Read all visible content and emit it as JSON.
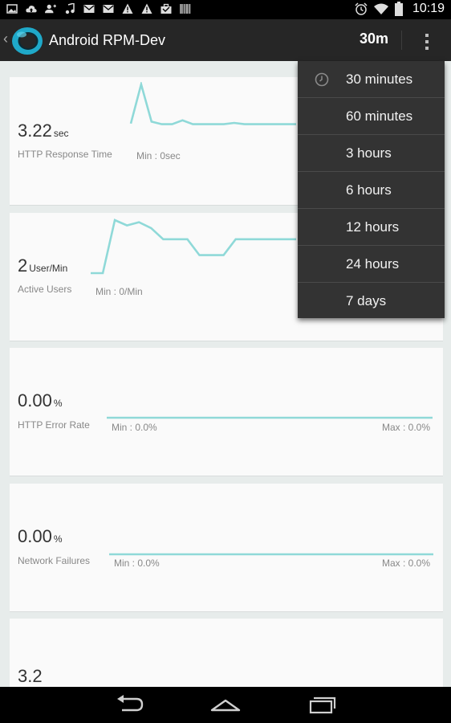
{
  "status_bar": {
    "time": "10:19",
    "left_icons": [
      "image-icon",
      "cloud-upload-icon",
      "add-contact-icon",
      "music-note-icon",
      "mail-icon",
      "mail-icon",
      "warning-icon",
      "warning-icon",
      "briefcase-icon",
      "barcode-icon"
    ],
    "right_icons": [
      "alarm-icon",
      "wifi-icon",
      "battery-icon"
    ]
  },
  "action_bar": {
    "back_glyph": "‹",
    "title": "Android RPM-Dev",
    "range_label": "30m"
  },
  "metrics": [
    {
      "value": "3.22",
      "unit": "sec",
      "label": "HTTP Response Time",
      "min_label": "Min : 0sec",
      "max_label": "",
      "series": [
        0.39,
        1.0,
        0.42,
        0.38,
        0.38,
        0.44,
        0.38,
        0.38,
        0.38,
        0.38,
        0.4,
        0.38,
        0.38,
        0.38,
        0.38,
        0.38,
        0.38
      ]
    },
    {
      "value": "2",
      "unit": "User/Min",
      "label": "Active Users",
      "min_label": "Min : 0/Min",
      "max_label": "",
      "series": [
        0.0,
        0.0,
        1.0,
        0.9,
        0.96,
        0.85,
        0.64,
        0.64,
        0.64,
        0.34,
        0.34,
        0.34,
        0.64,
        0.64,
        0.64,
        0.64,
        0.64,
        0.64
      ]
    },
    {
      "value": "0.00",
      "unit": "%",
      "label": "HTTP Error Rate",
      "min_label": "Min : 0.0%",
      "max_label": "Max : 0.0%",
      "series": [
        0,
        0
      ]
    },
    {
      "value": "0.00",
      "unit": "%",
      "label": "Network Failures",
      "min_label": "Min : 0.0%",
      "max_label": "Max : 0.0%",
      "series": [
        0,
        0
      ]
    },
    {
      "value": "3.2",
      "unit": "",
      "label": "",
      "min_label": "",
      "max_label": "",
      "series": []
    }
  ],
  "dropdown": {
    "items": [
      {
        "label": "30 minutes",
        "selected": true
      },
      {
        "label": "60 minutes",
        "selected": false
      },
      {
        "label": "3 hours",
        "selected": false
      },
      {
        "label": "6 hours",
        "selected": false
      },
      {
        "label": "12 hours",
        "selected": false
      },
      {
        "label": "24 hours",
        "selected": false
      },
      {
        "label": "7 days",
        "selected": false
      }
    ]
  },
  "colors": {
    "accent_line": "#8fd9d8",
    "action_bar": "#262626",
    "menu_bg": "#333333",
    "content_bg": "#e7eceb",
    "card_bg": "#fafafa"
  },
  "nav_bar": {
    "buttons": [
      "back-icon",
      "home-icon",
      "recent-apps-icon"
    ]
  }
}
